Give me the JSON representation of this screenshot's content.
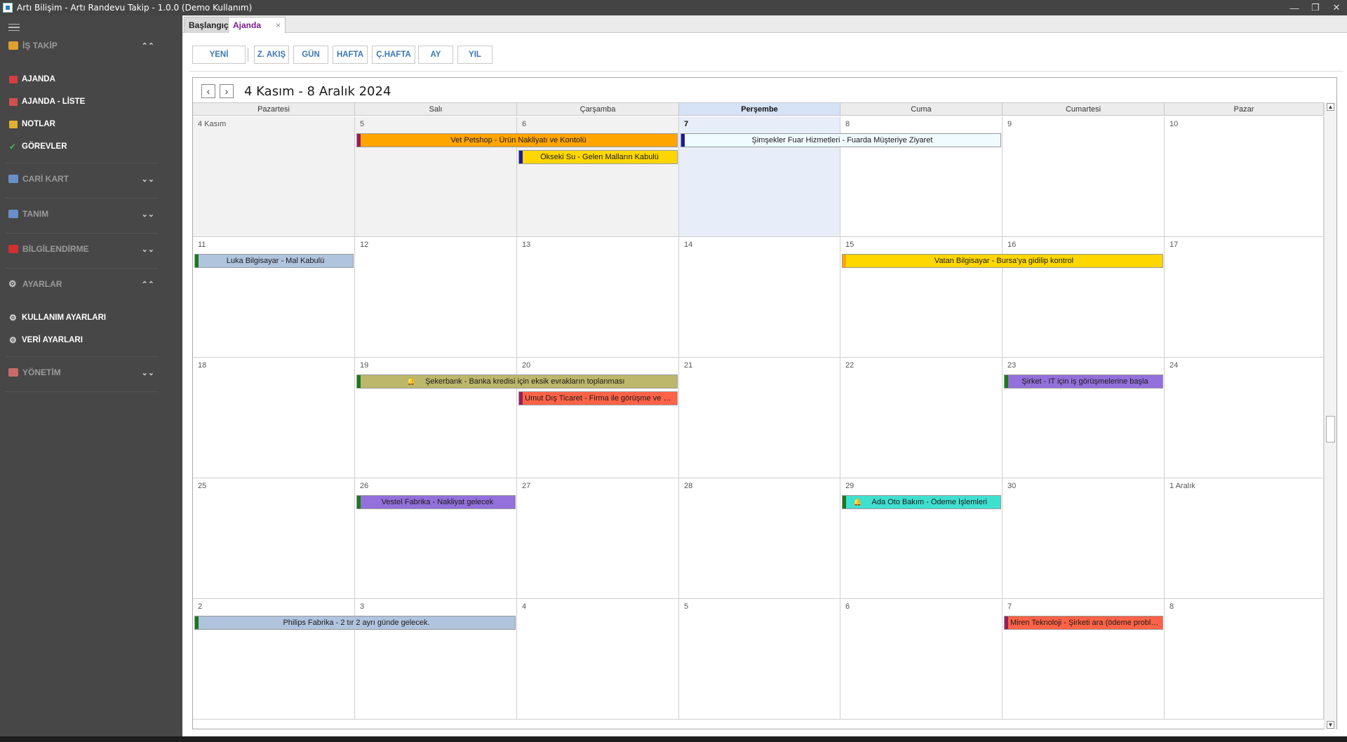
{
  "window": {
    "title": "Artı Bilişim - Artı Randevu Takip - 1.0.0 (Demo Kullanım)",
    "minimize": "—",
    "restore": "❐",
    "close": "✕"
  },
  "sidebar": {
    "sections": [
      {
        "label": "İŞ TAKİP",
        "chevron": "⌃⌃",
        "icon_color": "#e0a030"
      },
      {
        "label": "CARİ KART",
        "chevron": "⌄⌄",
        "icon_color": "#6a8fc8"
      },
      {
        "label": "TANIM",
        "chevron": "⌄⌄",
        "icon_color": "#6a8fc8"
      },
      {
        "label": "BİLGİLENDİRME",
        "chevron": "⌄⌄",
        "icon_color": "#d03030"
      },
      {
        "label": "AYARLAR",
        "chevron": "⌃⌃",
        "icon_color": "#c8c8c8"
      },
      {
        "label": "YÖNETİM",
        "chevron": "⌄⌄",
        "icon_color": "#c86a6a"
      }
    ],
    "items": [
      {
        "label": "AJANDA",
        "icon_color": "#d04040"
      },
      {
        "label": "AJANDA - LİSTE",
        "icon_color": "#d05050"
      },
      {
        "label": "NOTLAR",
        "icon_color": "#e0b030"
      },
      {
        "label": "GÖREVLER",
        "icon_color": "#50c050"
      },
      {
        "label": "KULLANIM AYARLARI",
        "icon_color": "#e0e0e0"
      },
      {
        "label": "VERİ AYARLARI",
        "icon_color": "#e0e0e0"
      }
    ]
  },
  "tabs": {
    "start": "Başlangıç",
    "ajanda": "Ajanda",
    "close": "×"
  },
  "toolbar": {
    "new": "YENİ",
    "timeline": "Z. AKIŞ",
    "day": "GÜN",
    "week": "HAFTA",
    "workweek": "Ç.HAFTA",
    "month": "AY",
    "year": "YIL"
  },
  "calendar": {
    "title": "4 Kasım - 8 Aralık 2024",
    "prev": "‹",
    "next": "›",
    "days": [
      "Pazartesi",
      "Salı",
      "Çarşamba",
      "Perşembe",
      "Cuma",
      "Cumartesi",
      "Pazar"
    ],
    "today_col": 3,
    "weeks": [
      [
        "4 Kasım",
        "5",
        "6",
        "7",
        "8",
        "9",
        "10"
      ],
      [
        "11",
        "12",
        "13",
        "14",
        "15",
        "16",
        "17"
      ],
      [
        "18",
        "19",
        "20",
        "21",
        "22",
        "23",
        "24"
      ],
      [
        "25",
        "26",
        "27",
        "28",
        "29",
        "30",
        "1 Aralık"
      ],
      [
        "2",
        "3",
        "4",
        "5",
        "6",
        "7",
        "8"
      ]
    ],
    "appointments": [
      {
        "text": "Vet Petshop - Ürün Nakliyatı ve Kontolü",
        "week": 0,
        "start": 1,
        "span": 2,
        "lane": 0,
        "bg": "#ffa500",
        "stripe": "#9b1b5a",
        "bell": false
      },
      {
        "text": "Şimşekler Fuar Hizmetleri - Fuarda Müşteriye Ziyaret",
        "week": 0,
        "start": 3,
        "span": 2,
        "lane": 0,
        "bg": "#f0fbff",
        "stripe": "#1a1aa0",
        "bell": false
      },
      {
        "text": "Ökseki Su - Gelen Malların Kabulü",
        "week": 0,
        "start": 2,
        "span": 1,
        "lane": 1,
        "bg": "#ffd700",
        "stripe": "#1a1aa0",
        "bell": false
      },
      {
        "text": "Luka Bilgisayar - Mal Kabulü",
        "week": 1,
        "start": 0,
        "span": 1,
        "lane": 0,
        "bg": "#b0c4de",
        "stripe": "#1a7a1a",
        "bell": false
      },
      {
        "text": "Vatan Bilgisayar - Bursa'ya gidilip kontrol",
        "week": 1,
        "start": 4,
        "span": 2,
        "lane": 0,
        "bg": "#ffd700",
        "stripe": "#ffa500",
        "bell": false
      },
      {
        "text": "Şekerbank - Banka kredisi için eksik evrakların toplanması",
        "week": 2,
        "start": 1,
        "span": 2,
        "lane": 0,
        "bg": "#bdb76b",
        "stripe": "#1a7a1a",
        "bell": true
      },
      {
        "text": "Umut Dış Ticaret - Firma ile görüşme ve ziyaret",
        "week": 2,
        "start": 2,
        "span": 1,
        "lane": 1,
        "bg": "#ff6347",
        "stripe": "#9b1b5a",
        "bell": false
      },
      {
        "text": "Şirket - IT için iş görüşmelerine başla",
        "week": 2,
        "start": 5,
        "span": 1,
        "lane": 0,
        "bg": "#9370db",
        "stripe": "#1a7a1a",
        "bell": false
      },
      {
        "text": "Vestel Fabrika - Nakliyat gelecek",
        "week": 3,
        "start": 1,
        "span": 1,
        "lane": 0,
        "bg": "#9370db",
        "stripe": "#1a7a1a",
        "bell": false
      },
      {
        "text": "Ada Oto Bakım - Ödeme İşlemleri",
        "week": 3,
        "start": 4,
        "span": 1,
        "lane": 0,
        "bg": "#40e0d0",
        "stripe": "#1a7a1a",
        "bell": true
      },
      {
        "text": "Philips Fabrika - 2 tır 2 ayrı günde gelecek.",
        "week": 4,
        "start": 0,
        "span": 2,
        "lane": 0,
        "bg": "#b0c4de",
        "stripe": "#1a7a1a",
        "bell": false
      },
      {
        "text": "Miren Teknoloji - Şirketi ara (ödeme problemi)",
        "week": 4,
        "start": 5,
        "span": 1,
        "lane": 0,
        "bg": "#ff6347",
        "stripe": "#9b1b5a",
        "bell": false
      }
    ],
    "out_of_range_cells": [
      [
        0,
        0
      ],
      [
        0,
        1
      ],
      [
        0,
        2
      ]
    ],
    "scroll_up": "▲",
    "scroll_down": "▼"
  }
}
